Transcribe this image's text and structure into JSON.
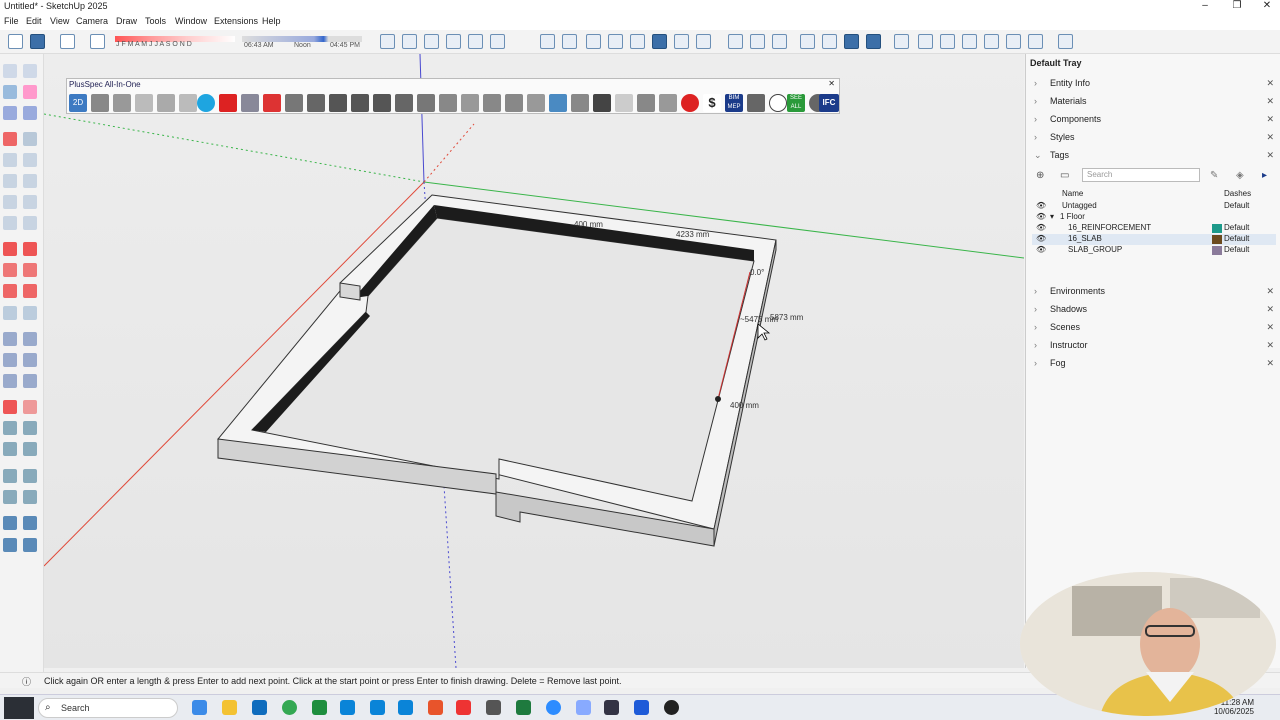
{
  "window": {
    "title": "Untitled* - SketchUp 2025"
  },
  "menu": [
    "File",
    "Edit",
    "View",
    "Camera",
    "Draw",
    "Tools",
    "Window",
    "Extensions",
    "Help"
  ],
  "shadow": {
    "months": "J F M A M J J A S O N D",
    "time_start": "06:43 AM",
    "time_noon": "Noon",
    "time_end": "04:45 PM"
  },
  "plugin_toolbar": {
    "title": "PlusSpec All-In-One",
    "icon_2d": "2D",
    "icon_bim": "BIM MEP",
    "icon_see_all": "SEE ALL",
    "icon_ifc": "IFC",
    "icon_dollar": "$"
  },
  "model": {
    "dims": [
      {
        "label": "400 mm"
      },
      {
        "label": "4233 mm"
      },
      {
        "label": "0.0°"
      },
      {
        "label": "~5475 mm"
      },
      {
        "label": "5873 mm"
      },
      {
        "label": "400 mm"
      }
    ]
  },
  "tray": {
    "title": "Default Tray",
    "panels_top": [
      "Entity Info",
      "Materials",
      "Components",
      "Styles",
      "Tags"
    ],
    "panels_bottom": [
      "Environments",
      "Shadows",
      "Scenes",
      "Instructor",
      "Fog"
    ],
    "search_placeholder": "Search",
    "col_name": "Name",
    "col_dashes": "Dashes",
    "tags": [
      {
        "name": "Untagged",
        "dash": "Default",
        "color": ""
      },
      {
        "name": "1 Floor",
        "dash": "",
        "color": ""
      },
      {
        "name": "16_REINFORCEMENT",
        "dash": "Default",
        "color": "#1d9a8a"
      },
      {
        "name": "16_SLAB",
        "dash": "Default",
        "color": "#6b4a1e"
      },
      {
        "name": "SLAB_GROUP",
        "dash": "Default",
        "color": "#8a7a9a"
      }
    ]
  },
  "status": {
    "message": "Click again OR enter a length & press Enter to add next point. Click at the start point or press Enter to finish drawing. Delete = Remove last point."
  },
  "taskbar": {
    "search_label": "Search",
    "time": "11:28 AM",
    "date": "10/06/2025"
  },
  "colors": {
    "axis_red": "#e04a3a",
    "axis_green": "#3ab54a",
    "axis_blue": "#4a4ad0",
    "wall_top": "#f4f4f4",
    "wall_side": "#cfcfcf",
    "wall_inner": "#1c1c1c"
  }
}
